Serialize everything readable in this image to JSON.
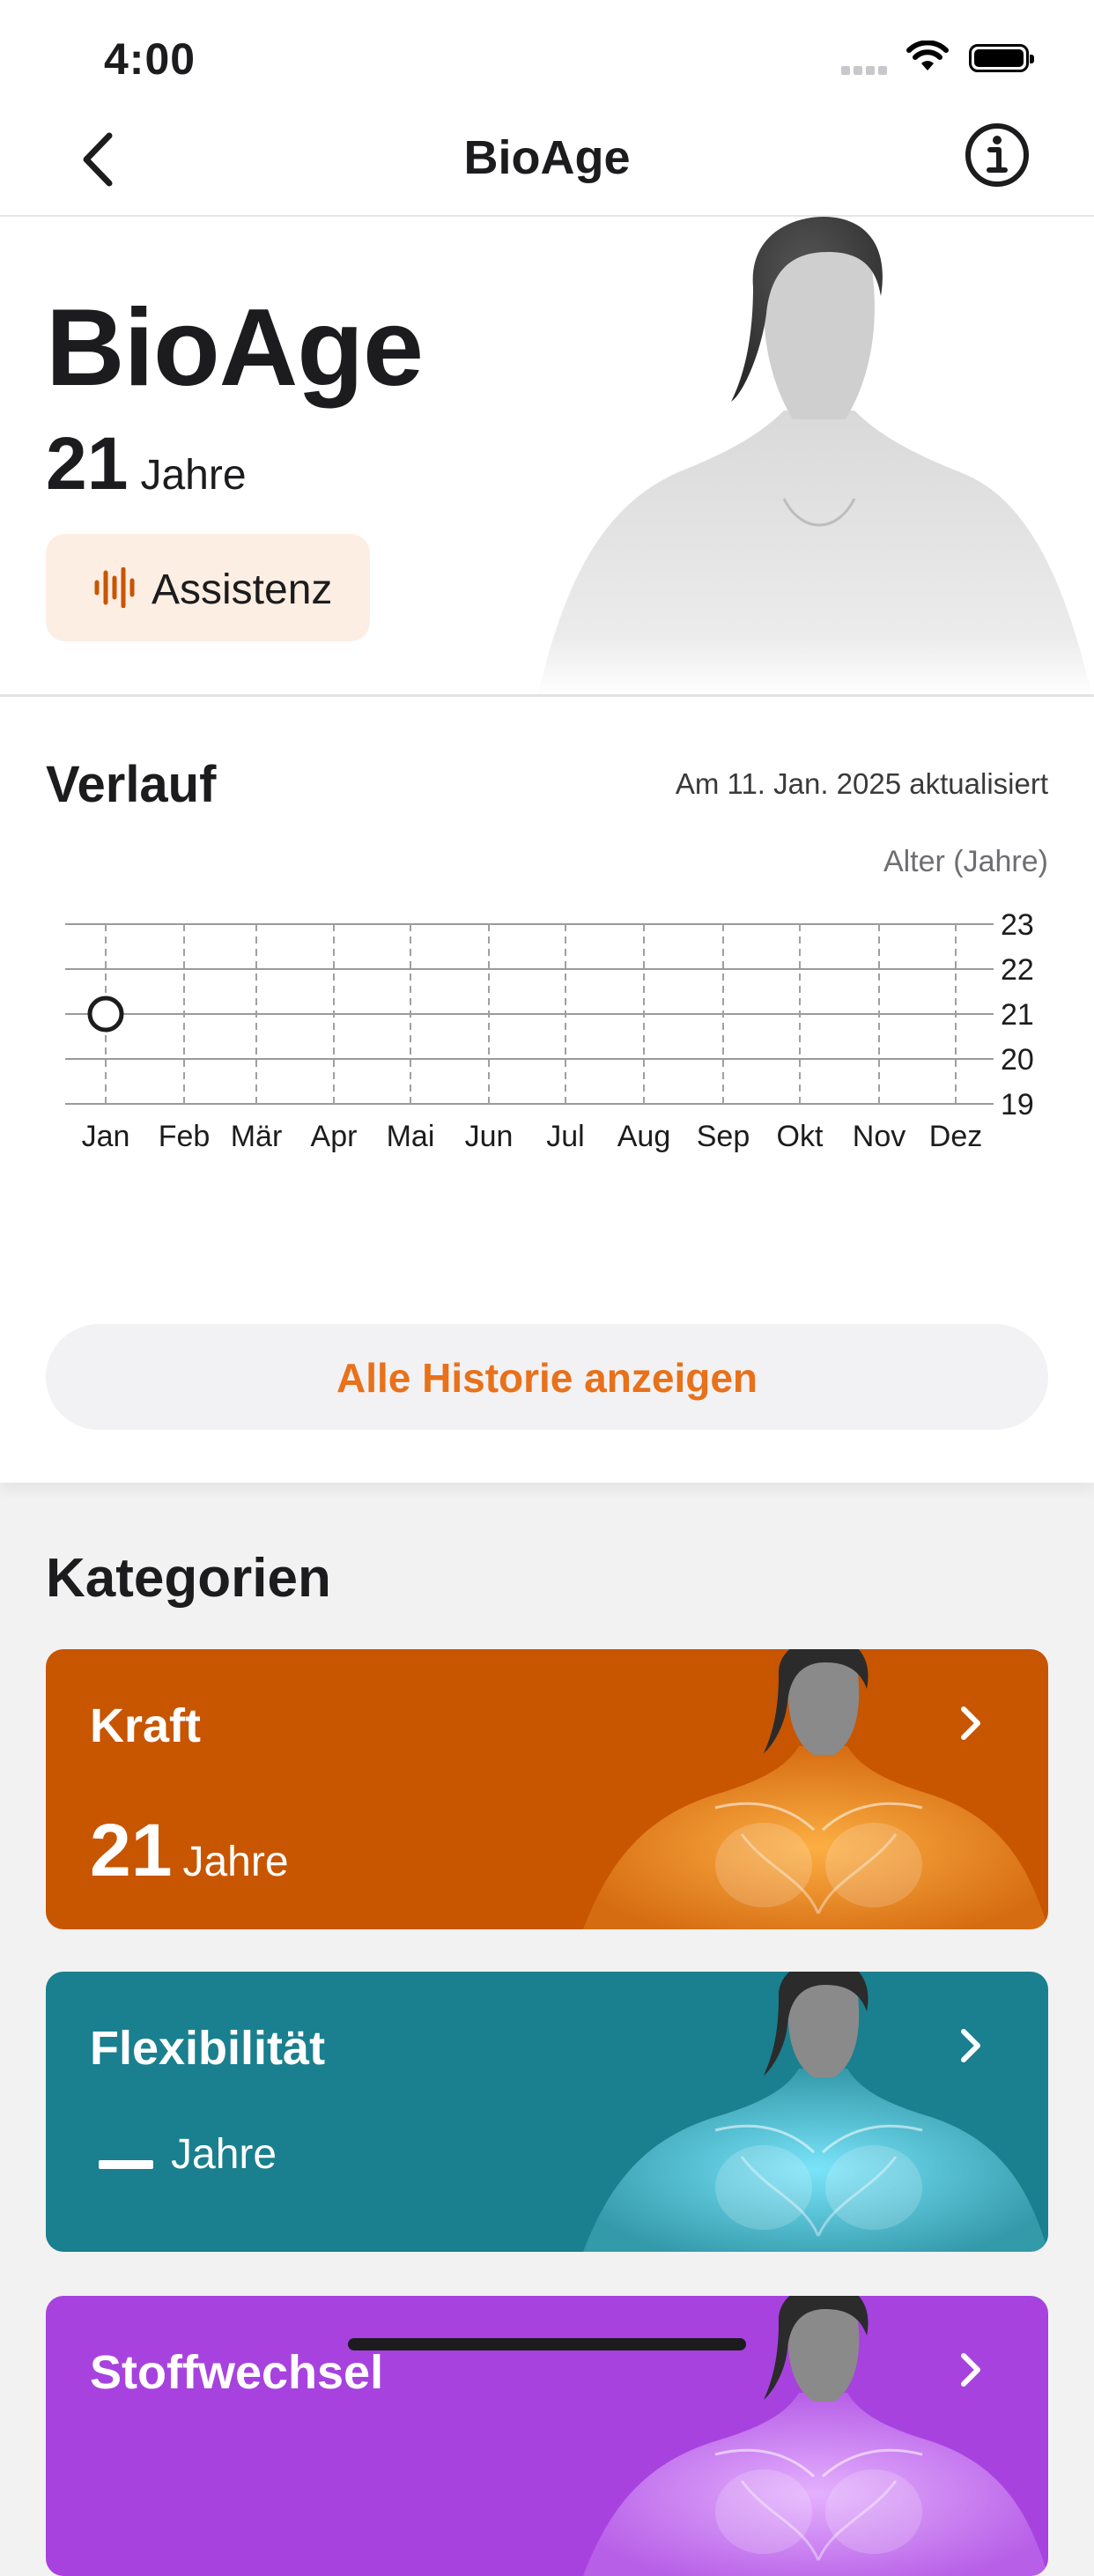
{
  "status_bar": {
    "time": "4:00"
  },
  "nav": {
    "title": "BioAge",
    "back_icon": "chevron-left-icon",
    "info_icon": "info-circle-icon"
  },
  "hero": {
    "title": "BioAge",
    "age_value": "21",
    "age_unit": "Jahre",
    "assist_label": "Assistenz",
    "assist_icon": "waveform-icon",
    "assist_color": "#c85500",
    "assist_bg": "#fdeee4"
  },
  "history": {
    "title": "Verlauf",
    "updated": "Am 11. Jan. 2025 aktualisiert",
    "button_label": "Alle Historie anzeigen",
    "button_color": "#e8711a"
  },
  "chart_data": {
    "type": "scatter",
    "xlabel": "",
    "ylabel": "Alter (Jahre)",
    "categories": [
      "Jan",
      "Feb",
      "Mär",
      "Apr",
      "Mai",
      "Jun",
      "Jul",
      "Aug",
      "Sep",
      "Okt",
      "Nov",
      "Dez"
    ],
    "y_ticks": [
      "23",
      "22",
      "21",
      "20",
      "19"
    ],
    "ylim": [
      19,
      23
    ],
    "series": [
      {
        "points": [
          {
            "x": "Jan",
            "y": 21
          }
        ]
      }
    ],
    "grid": true,
    "y_axis_position": "right"
  },
  "categories": {
    "title": "Kategorien",
    "items": [
      {
        "name": "Kraft",
        "value": "21",
        "unit": "Jahre",
        "color": "#c85500",
        "glow": "#ffb347"
      },
      {
        "name": "Flexibilität",
        "value": "",
        "unit": "Jahre",
        "color": "#1a7f8e",
        "glow": "#7fe9ff"
      },
      {
        "name": "Stoffwechsel",
        "value": "",
        "unit": "",
        "color": "#a742df",
        "glow": "#e7b6ff"
      }
    ]
  }
}
